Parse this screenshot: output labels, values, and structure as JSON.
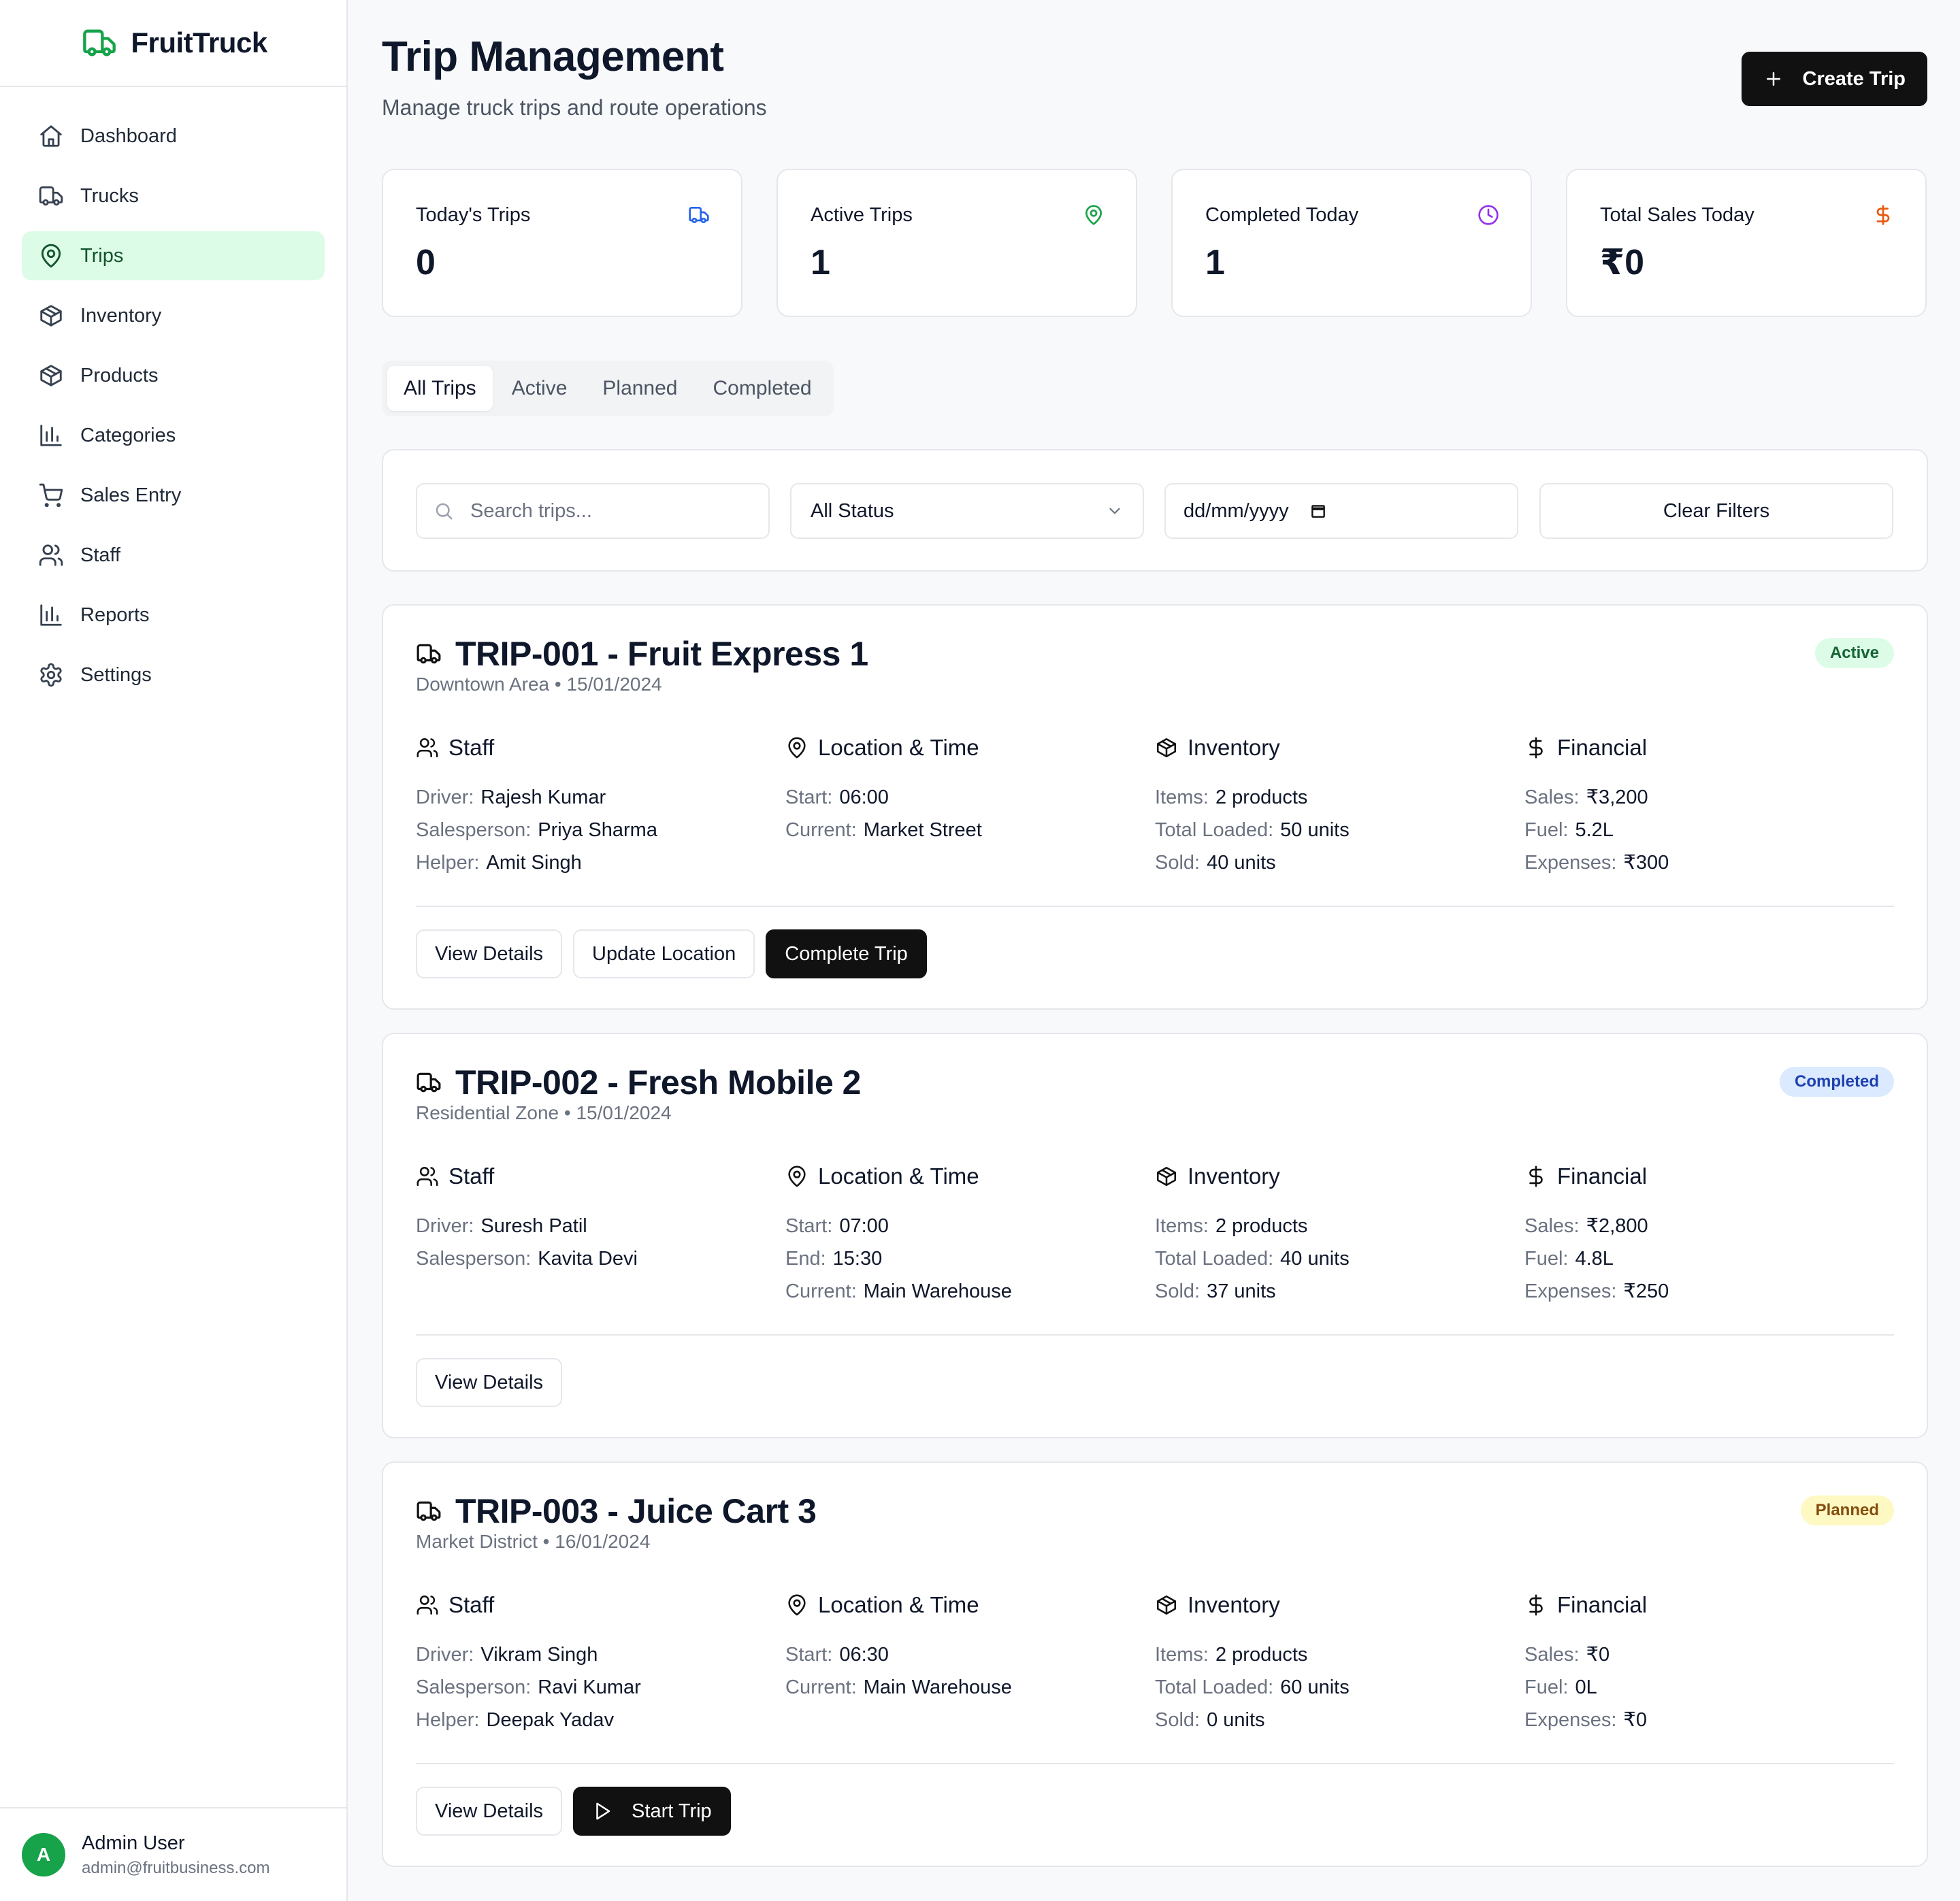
{
  "app": {
    "name": "FruitTruck",
    "brand_color": "#16a34a"
  },
  "sidebar": {
    "items": [
      {
        "label": "Dashboard",
        "icon": "home-icon"
      },
      {
        "label": "Trucks",
        "icon": "truck-icon"
      },
      {
        "label": "Trips",
        "icon": "map-pin-icon",
        "active": true
      },
      {
        "label": "Inventory",
        "icon": "package-icon"
      },
      {
        "label": "Products",
        "icon": "package-icon"
      },
      {
        "label": "Categories",
        "icon": "bar-chart-icon"
      },
      {
        "label": "Sales Entry",
        "icon": "cart-icon"
      },
      {
        "label": "Staff",
        "icon": "users-icon"
      },
      {
        "label": "Reports",
        "icon": "bar-chart-icon"
      },
      {
        "label": "Settings",
        "icon": "gear-icon"
      }
    ],
    "user": {
      "initial": "A",
      "name": "Admin User",
      "email": "admin@fruitbusiness.com"
    }
  },
  "header": {
    "title": "Trip Management",
    "subtitle": "Manage truck trips and route operations",
    "create_label": "Create Trip"
  },
  "stats": [
    {
      "label": "Today's Trips",
      "value": "0",
      "icon": "truck-icon",
      "color": "#2563eb"
    },
    {
      "label": "Active Trips",
      "value": "1",
      "icon": "map-pin-icon",
      "color": "#16a34a"
    },
    {
      "label": "Completed Today",
      "value": "1",
      "icon": "clock-icon",
      "color": "#9333ea"
    },
    {
      "label": "Total Sales Today",
      "value": "₹0",
      "icon": "dollar-icon",
      "color": "#ea580c"
    }
  ],
  "tabs": [
    "All Trips",
    "Active",
    "Planned",
    "Completed"
  ],
  "filters": {
    "search_placeholder": "Search trips...",
    "status_value": "All Status",
    "date_placeholder": "dd/mm/yyyy",
    "clear_label": "Clear Filters"
  },
  "section_labels": {
    "staff": "Staff",
    "location": "Location & Time",
    "inventory": "Inventory",
    "financial": "Financial"
  },
  "trips": [
    {
      "title": "TRIP-001 - Fruit Express 1",
      "subtitle": "Downtown Area • 15/01/2024",
      "status": "Active",
      "staff": [
        {
          "k": "Driver:",
          "v": "Rajesh Kumar"
        },
        {
          "k": "Salesperson:",
          "v": "Priya Sharma"
        },
        {
          "k": "Helper:",
          "v": "Amit Singh"
        }
      ],
      "location": [
        {
          "k": "Start:",
          "v": "06:00"
        },
        {
          "k": "Current:",
          "v": "Market Street"
        }
      ],
      "inventory": [
        {
          "k": "Items:",
          "v": "2 products"
        },
        {
          "k": "Total Loaded:",
          "v": "50 units"
        },
        {
          "k": "Sold:",
          "v": "40 units"
        }
      ],
      "financial": [
        {
          "k": "Sales:",
          "v": "₹3,200"
        },
        {
          "k": "Fuel:",
          "v": "5.2L"
        },
        {
          "k": "Expenses:",
          "v": "₹300"
        }
      ],
      "actions": [
        "View Details",
        "Update Location",
        "Complete Trip"
      ]
    },
    {
      "title": "TRIP-002 - Fresh Mobile 2",
      "subtitle": "Residential Zone • 15/01/2024",
      "status": "Completed",
      "staff": [
        {
          "k": "Driver:",
          "v": "Suresh Patil"
        },
        {
          "k": "Salesperson:",
          "v": "Kavita Devi"
        }
      ],
      "location": [
        {
          "k": "Start:",
          "v": "07:00"
        },
        {
          "k": "End:",
          "v": "15:30"
        },
        {
          "k": "Current:",
          "v": "Main Warehouse"
        }
      ],
      "inventory": [
        {
          "k": "Items:",
          "v": "2 products"
        },
        {
          "k": "Total Loaded:",
          "v": "40 units"
        },
        {
          "k": "Sold:",
          "v": "37 units"
        }
      ],
      "financial": [
        {
          "k": "Sales:",
          "v": "₹2,800"
        },
        {
          "k": "Fuel:",
          "v": "4.8L"
        },
        {
          "k": "Expenses:",
          "v": "₹250"
        }
      ],
      "actions": [
        "View Details"
      ]
    },
    {
      "title": "TRIP-003 - Juice Cart 3",
      "subtitle": "Market District • 16/01/2024",
      "status": "Planned",
      "staff": [
        {
          "k": "Driver:",
          "v": "Vikram Singh"
        },
        {
          "k": "Salesperson:",
          "v": "Ravi Kumar"
        },
        {
          "k": "Helper:",
          "v": "Deepak Yadav"
        }
      ],
      "location": [
        {
          "k": "Start:",
          "v": "06:30"
        },
        {
          "k": "Current:",
          "v": "Main Warehouse"
        }
      ],
      "inventory": [
        {
          "k": "Items:",
          "v": "2 products"
        },
        {
          "k": "Total Loaded:",
          "v": "60 units"
        },
        {
          "k": "Sold:",
          "v": "0 units"
        }
      ],
      "financial": [
        {
          "k": "Sales:",
          "v": "₹0"
        },
        {
          "k": "Fuel:",
          "v": "0L"
        },
        {
          "k": "Expenses:",
          "v": "₹0"
        }
      ],
      "actions": [
        "View Details",
        "Start Trip"
      ]
    }
  ]
}
